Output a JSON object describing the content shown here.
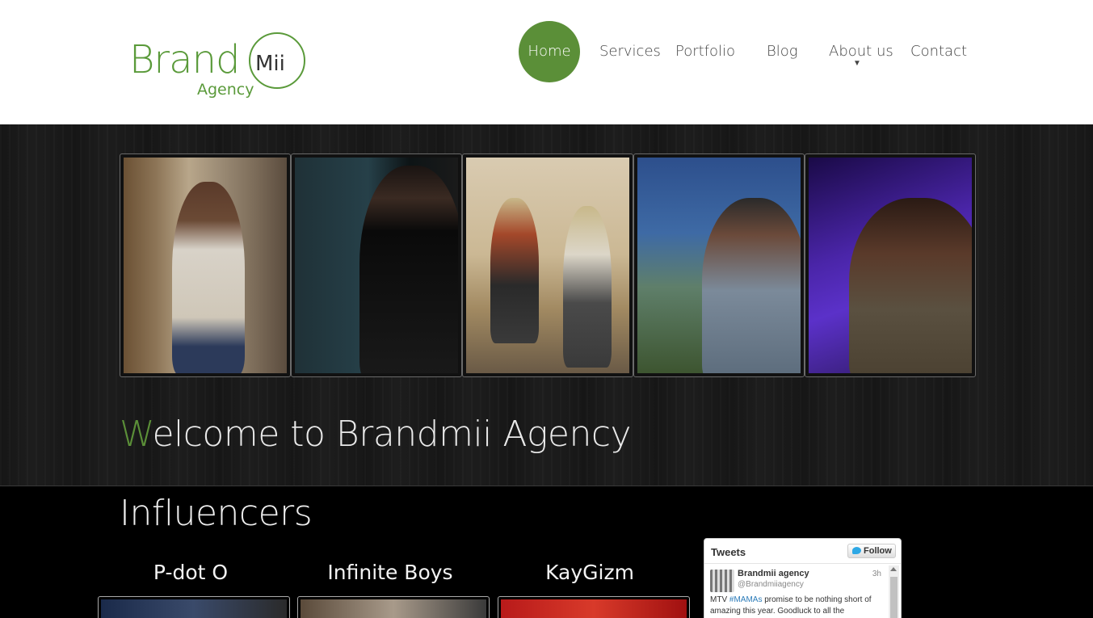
{
  "header": {
    "logo": {
      "brand": "Brand",
      "mii": "Mii",
      "agency": "Agency"
    },
    "nav": [
      {
        "label": "Home",
        "active": true
      },
      {
        "label": "Services"
      },
      {
        "label": "Portfolio"
      },
      {
        "label": "Blog"
      },
      {
        "label": "About us",
        "has_dropdown": true
      },
      {
        "label": "Contact"
      }
    ],
    "accent_color": "#5b8f38"
  },
  "hero": {
    "welcome_first_letter": "W",
    "welcome_rest": "elcome to Brandmii Agency",
    "gallery_images": [
      "artist-hoodie-photo",
      "johnnie-walker-backdrop-photo",
      "jumping-duo-photo",
      "stage-performer-cap-photo",
      "purple-stage-photo"
    ]
  },
  "influencers": {
    "heading": "Influencers",
    "cards": [
      {
        "name": "P-dot O"
      },
      {
        "name": "Infinite Boys"
      },
      {
        "name": "KayGizm"
      }
    ]
  },
  "tweets_widget": {
    "title": "Tweets",
    "follow_label": "Follow",
    "tweet": {
      "name": "Brandmii agency",
      "handle": "@Brandmiiagency",
      "time": "3h",
      "text_before": "MTV ",
      "hashtag": "#MAMAs",
      "text_after": " promise to be nothing short of amazing this year. Goodluck to all the"
    }
  }
}
